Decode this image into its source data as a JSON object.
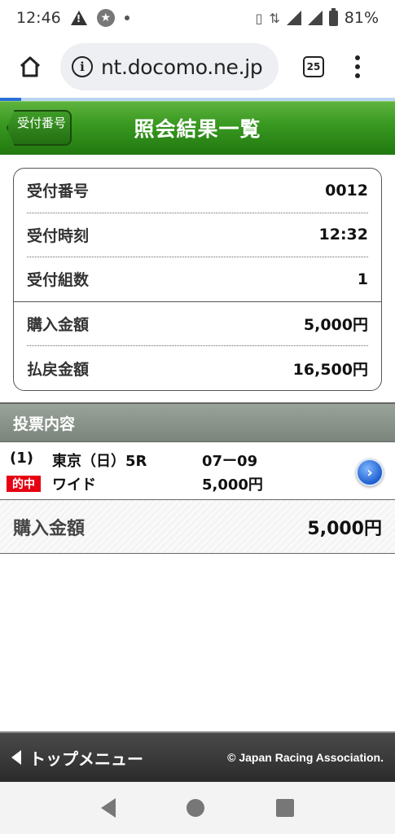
{
  "status_bar": {
    "time": "12:46",
    "battery": "81%"
  },
  "browser": {
    "url": "nt.docomo.ne.jp",
    "tab_count": "25"
  },
  "header": {
    "back_label": "受付番号",
    "title": "照会結果一覧"
  },
  "summary": {
    "rows": [
      {
        "label": "受付番号",
        "value": "0012"
      },
      {
        "label": "受付時刻",
        "value": "12:32"
      },
      {
        "label": "受付組数",
        "value": "1"
      },
      {
        "label": "購入金額",
        "value": "5,000円"
      },
      {
        "label": "払戻金額",
        "value": "16,500円"
      }
    ]
  },
  "section": {
    "title": "投票内容"
  },
  "bet": {
    "index": "(1)",
    "race": "東京（日）5R",
    "numbers": "07ー09",
    "badge": "的中",
    "type": "ワイド",
    "amount": "5,000円"
  },
  "total": {
    "label": "購入金額",
    "value": "5,000円"
  },
  "footer": {
    "top_menu": "トップメニュー",
    "copyright": "© Japan Racing Association."
  },
  "colors": {
    "title_green": "#3a9a22",
    "hit_red": "#e60012",
    "arrow_blue": "#1f5fd0"
  }
}
